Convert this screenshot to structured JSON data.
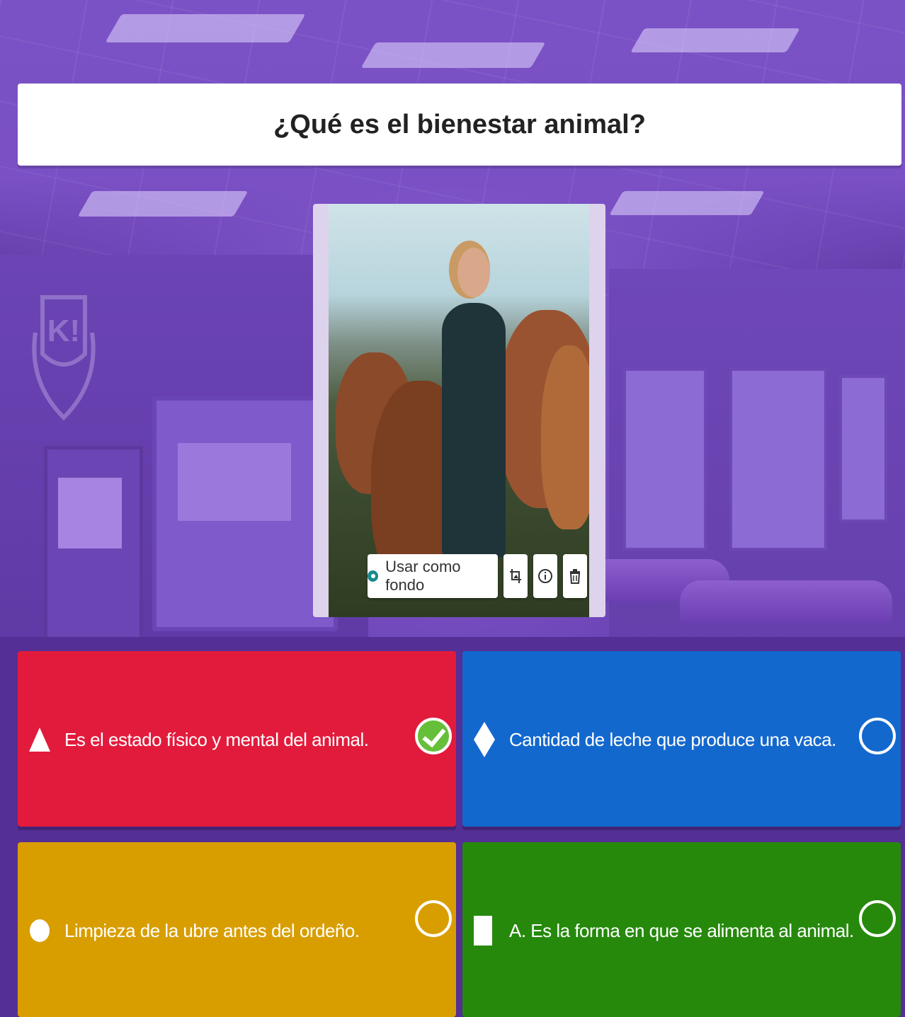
{
  "question": {
    "text": "¿Qué es el bienestar animal?"
  },
  "media": {
    "use_as_background_label": "Usar como fondo",
    "tools": [
      {
        "icon": "crop-icon"
      },
      {
        "icon": "info-icon"
      },
      {
        "icon": "trash-icon"
      }
    ]
  },
  "answers": [
    {
      "shape": "triangle",
      "text": "Es el estado físico y mental del animal.",
      "color": "#e21b3c",
      "correct": true
    },
    {
      "shape": "diamond",
      "text": "Cantidad de leche que produce una vaca.",
      "color": "#1368ce",
      "correct": false
    },
    {
      "shape": "circle",
      "text": "Limpieza de la ubre antes del ordeño.",
      "color": "#d89e00",
      "correct": false
    },
    {
      "shape": "square",
      "text": "A. Es la forma en que se alimenta al animal.",
      "color": "#26890c",
      "correct": false
    }
  ],
  "colors": {
    "background": "#6e46b8",
    "correct_check": "#66bf39"
  }
}
